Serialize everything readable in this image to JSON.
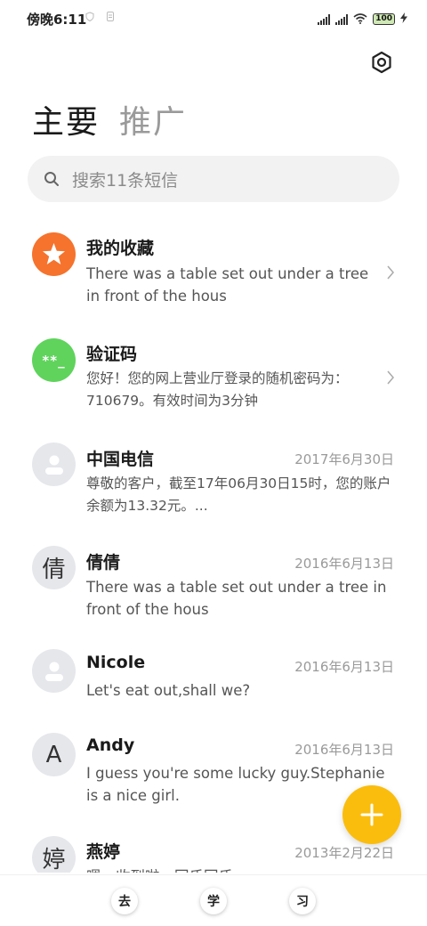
{
  "status_bar": {
    "time": "傍晚6:11",
    "battery": "100",
    "icons": [
      "shield-icon",
      "sim-icon",
      "signal-icon",
      "signal-icon",
      "wifi-icon",
      "battery-icon",
      "charging-icon"
    ]
  },
  "header": {
    "tabs": [
      {
        "label": "主要",
        "active": true
      },
      {
        "label": "推广",
        "active": false
      }
    ],
    "settings_icon": "settings-icon"
  },
  "search": {
    "placeholder": "搜索11条短信",
    "icon": "search-icon"
  },
  "conversations": [
    {
      "name": "我的收藏",
      "date": "",
      "preview": "There was a table set out under a tree in front of the hous",
      "avatar": "star-icon",
      "avatar_color": "#f5732d",
      "chevron": true
    },
    {
      "name": "验证码",
      "date": "",
      "preview": "您好！您的网上营业厅登录的随机密码为：710679。有效时间为3分钟",
      "avatar": "verification-code-icon",
      "avatar_text": "**_",
      "avatar_color": "#5fd35c",
      "chevron": true
    },
    {
      "name": "中国电信",
      "date": "2017年6月30日",
      "preview": "尊敬的客户，截至17年06月30日15时，您的账户余额为13.32元。...",
      "avatar": "person-icon"
    },
    {
      "name": "倩倩",
      "date": "2016年6月13日",
      "preview": "There was a table set out under a tree in front of the hous",
      "avatar_char": "倩"
    },
    {
      "name": "Nicole",
      "date": "2016年6月13日",
      "preview": "Let's eat out,shall we?",
      "avatar": "person-icon"
    },
    {
      "name": "Andy",
      "date": "2016年6月13日",
      "preview": "I guess you're some lucky guy.Stephanie is a nice girl.",
      "avatar_char": "A"
    },
    {
      "name": "燕婷",
      "date": "2013年2月22日",
      "preview": "嗯，收到啦，回氏回氏",
      "avatar_char": "婷"
    }
  ],
  "fab": {
    "icon": "plus-icon"
  },
  "bottom_bar": {
    "buttons": [
      "去",
      "学",
      "习"
    ]
  },
  "colors": {
    "accent": "#fbbd0d",
    "favorites": "#f5732d",
    "verification": "#5fd35c",
    "avatar_gray": "#e6e7eb"
  }
}
